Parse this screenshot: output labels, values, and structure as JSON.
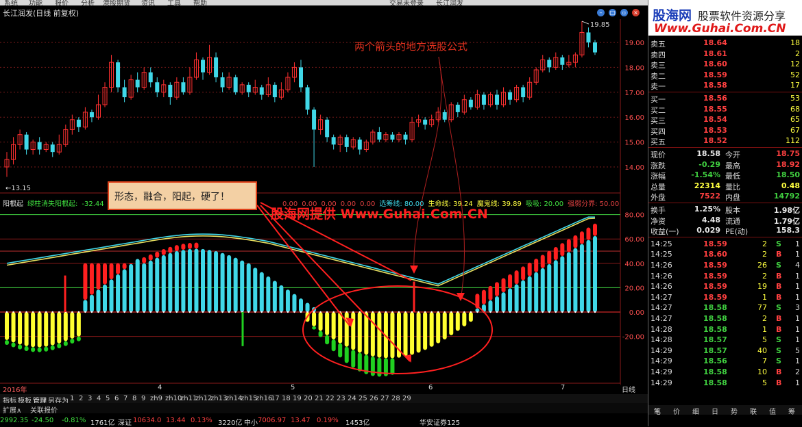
{
  "menubar": {
    "items": [
      "系统",
      "功能",
      "报价",
      "分析",
      "港股期货",
      "资讯",
      "工具",
      "帮助",
      "交易未登录",
      "长江润发"
    ]
  },
  "window": {
    "title": "长江润发(日线 前复权)"
  },
  "main_chart": {
    "price_axis": [
      "19.00",
      "18.00",
      "17.00",
      "16.00",
      "15.00",
      "14.00"
    ],
    "high_label": "19.85",
    "low_label": "13.15",
    "candles": [
      {
        "o": 14.0,
        "c": 14.3,
        "h": 14.6,
        "l": 13.6
      },
      {
        "o": 14.3,
        "c": 14.9,
        "h": 15.2,
        "l": 14.1
      },
      {
        "o": 14.9,
        "c": 15.3,
        "h": 15.5,
        "l": 14.7
      },
      {
        "o": 15.3,
        "c": 14.7,
        "h": 15.4,
        "l": 14.5
      },
      {
        "o": 14.7,
        "c": 15.0,
        "h": 15.1,
        "l": 14.5
      },
      {
        "o": 15.0,
        "c": 14.7,
        "h": 15.2,
        "l": 14.5
      },
      {
        "o": 14.7,
        "c": 14.9,
        "h": 15.0,
        "l": 14.6
      },
      {
        "o": 14.9,
        "c": 14.6,
        "h": 15.0,
        "l": 14.4
      },
      {
        "o": 14.6,
        "c": 14.9,
        "h": 15.3,
        "l": 14.5
      },
      {
        "o": 14.9,
        "c": 15.5,
        "h": 15.7,
        "l": 14.8
      },
      {
        "o": 15.5,
        "c": 15.9,
        "h": 16.1,
        "l": 15.3
      },
      {
        "o": 15.9,
        "c": 15.6,
        "h": 16.0,
        "l": 15.4
      },
      {
        "o": 15.6,
        "c": 16.2,
        "h": 16.4,
        "l": 15.5
      },
      {
        "o": 16.2,
        "c": 16.0,
        "h": 16.3,
        "l": 15.8
      },
      {
        "o": 16.0,
        "c": 16.5,
        "h": 16.9,
        "l": 15.9
      },
      {
        "o": 16.5,
        "c": 17.2,
        "h": 17.4,
        "l": 16.4
      },
      {
        "o": 17.2,
        "c": 18.2,
        "h": 18.5,
        "l": 17.0
      },
      {
        "o": 18.2,
        "c": 17.2,
        "h": 18.3,
        "l": 17.0
      },
      {
        "o": 17.2,
        "c": 16.8,
        "h": 17.5,
        "l": 16.6
      },
      {
        "o": 16.8,
        "c": 17.5,
        "h": 17.7,
        "l": 16.7
      },
      {
        "o": 17.5,
        "c": 17.2,
        "h": 17.8,
        "l": 17.0
      },
      {
        "o": 17.2,
        "c": 17.8,
        "h": 18.0,
        "l": 17.1
      },
      {
        "o": 17.8,
        "c": 17.4,
        "h": 18.0,
        "l": 17.2
      },
      {
        "o": 17.4,
        "c": 17.0,
        "h": 17.6,
        "l": 16.8
      },
      {
        "o": 17.0,
        "c": 17.3,
        "h": 17.5,
        "l": 16.8
      },
      {
        "o": 17.3,
        "c": 16.8,
        "h": 17.4,
        "l": 16.5
      },
      {
        "o": 16.8,
        "c": 17.4,
        "h": 17.6,
        "l": 16.7
      },
      {
        "o": 17.4,
        "c": 17.0,
        "h": 17.6,
        "l": 16.9
      },
      {
        "o": 17.0,
        "c": 17.6,
        "h": 18.0,
        "l": 16.9
      },
      {
        "o": 17.6,
        "c": 18.3,
        "h": 18.6,
        "l": 17.5
      },
      {
        "o": 18.3,
        "c": 17.8,
        "h": 18.4,
        "l": 17.5
      },
      {
        "o": 17.8,
        "c": 18.4,
        "h": 18.9,
        "l": 17.7
      },
      {
        "o": 18.4,
        "c": 17.6,
        "h": 18.6,
        "l": 17.4
      },
      {
        "o": 17.6,
        "c": 17.2,
        "h": 17.8,
        "l": 17.0
      },
      {
        "o": 17.2,
        "c": 17.6,
        "h": 17.8,
        "l": 17.1
      },
      {
        "o": 17.6,
        "c": 17.0,
        "h": 17.7,
        "l": 16.9
      },
      {
        "o": 17.0,
        "c": 17.3,
        "h": 17.4,
        "l": 16.9
      },
      {
        "o": 17.3,
        "c": 17.0,
        "h": 17.4,
        "l": 16.8
      },
      {
        "o": 17.0,
        "c": 17.2,
        "h": 17.5,
        "l": 16.9
      },
      {
        "o": 17.2,
        "c": 16.9,
        "h": 17.3,
        "l": 16.7
      },
      {
        "o": 16.9,
        "c": 17.3,
        "h": 17.6,
        "l": 16.8
      },
      {
        "o": 17.3,
        "c": 16.8,
        "h": 17.4,
        "l": 16.6
      },
      {
        "o": 16.8,
        "c": 17.1,
        "h": 17.4,
        "l": 16.7
      },
      {
        "o": 17.1,
        "c": 17.6,
        "h": 17.8,
        "l": 17.0
      },
      {
        "o": 17.6,
        "c": 18.0,
        "h": 18.2,
        "l": 17.4
      },
      {
        "o": 18.0,
        "c": 17.2,
        "h": 18.3,
        "l": 17.0
      },
      {
        "o": 17.2,
        "c": 16.3,
        "h": 17.3,
        "l": 16.1
      },
      {
        "o": 16.3,
        "c": 15.5,
        "h": 16.4,
        "l": 14.0
      },
      {
        "o": 15.5,
        "c": 15.9,
        "h": 16.1,
        "l": 15.3
      },
      {
        "o": 15.9,
        "c": 15.2,
        "h": 16.0,
        "l": 15.0
      },
      {
        "o": 15.2,
        "c": 14.9,
        "h": 15.3,
        "l": 14.7
      },
      {
        "o": 14.9,
        "c": 15.2,
        "h": 15.3,
        "l": 14.6
      },
      {
        "o": 15.2,
        "c": 14.8,
        "h": 15.3,
        "l": 14.6
      },
      {
        "o": 14.8,
        "c": 15.1,
        "h": 15.2,
        "l": 14.7
      },
      {
        "o": 15.1,
        "c": 14.7,
        "h": 15.2,
        "l": 14.5
      },
      {
        "o": 14.7,
        "c": 15.0,
        "h": 15.1,
        "l": 14.6
      },
      {
        "o": 15.0,
        "c": 15.4,
        "h": 15.5,
        "l": 14.9
      },
      {
        "o": 15.4,
        "c": 15.1,
        "h": 15.6,
        "l": 15.0
      },
      {
        "o": 15.1,
        "c": 15.3,
        "h": 15.4,
        "l": 15.0
      },
      {
        "o": 15.3,
        "c": 15.1,
        "h": 15.4,
        "l": 15.0
      },
      {
        "o": 15.1,
        "c": 15.3,
        "h": 15.4,
        "l": 15.0
      },
      {
        "o": 15.3,
        "c": 15.1,
        "h": 15.4,
        "l": 14.9
      },
      {
        "o": 15.1,
        "c": 15.8,
        "h": 16.0,
        "l": 15.0
      },
      {
        "o": 15.8,
        "c": 15.9,
        "h": 16.1,
        "l": 15.6
      },
      {
        "o": 15.9,
        "c": 15.7,
        "h": 16.0,
        "l": 15.5
      },
      {
        "o": 15.7,
        "c": 15.9,
        "h": 16.1,
        "l": 15.6
      },
      {
        "o": 15.9,
        "c": 16.2,
        "h": 16.4,
        "l": 15.8
      },
      {
        "o": 16.2,
        "c": 15.9,
        "h": 16.3,
        "l": 15.8
      },
      {
        "o": 15.9,
        "c": 16.5,
        "h": 16.6,
        "l": 15.8
      },
      {
        "o": 16.5,
        "c": 16.2,
        "h": 16.6,
        "l": 16.0
      },
      {
        "o": 16.2,
        "c": 16.7,
        "h": 16.9,
        "l": 16.1
      },
      {
        "o": 16.7,
        "c": 16.4,
        "h": 16.8,
        "l": 16.3
      },
      {
        "o": 16.4,
        "c": 16.9,
        "h": 17.1,
        "l": 16.3
      },
      {
        "o": 16.9,
        "c": 16.5,
        "h": 17.0,
        "l": 16.3
      },
      {
        "o": 16.5,
        "c": 16.9,
        "h": 17.0,
        "l": 16.4
      },
      {
        "o": 16.9,
        "c": 16.5,
        "h": 17.1,
        "l": 16.3
      },
      {
        "o": 16.5,
        "c": 17.0,
        "h": 17.2,
        "l": 16.4
      },
      {
        "o": 17.0,
        "c": 16.7,
        "h": 17.1,
        "l": 16.5
      },
      {
        "o": 16.7,
        "c": 17.2,
        "h": 17.3,
        "l": 16.6
      },
      {
        "o": 17.2,
        "c": 16.8,
        "h": 17.3,
        "l": 16.6
      },
      {
        "o": 16.8,
        "c": 17.4,
        "h": 17.6,
        "l": 16.7
      },
      {
        "o": 17.4,
        "c": 17.9,
        "h": 18.0,
        "l": 17.3
      },
      {
        "o": 17.9,
        "c": 18.3,
        "h": 18.5,
        "l": 17.8
      },
      {
        "o": 18.3,
        "c": 18.0,
        "h": 18.4,
        "l": 17.8
      },
      {
        "o": 18.0,
        "c": 18.4,
        "h": 18.6,
        "l": 17.9
      },
      {
        "o": 18.4,
        "c": 18.1,
        "h": 18.5,
        "l": 17.9
      },
      {
        "o": 18.1,
        "c": 18.2,
        "h": 18.5,
        "l": 18.0
      },
      {
        "o": 18.2,
        "c": 18.5,
        "h": 18.6,
        "l": 18.0
      },
      {
        "o": 18.5,
        "c": 19.4,
        "h": 19.85,
        "l": 18.4
      },
      {
        "o": 19.4,
        "c": 19.0,
        "h": 19.6,
        "l": 18.8
      },
      {
        "o": 19.0,
        "c": 18.6,
        "h": 19.1,
        "l": 18.5
      }
    ]
  },
  "indicator": {
    "name": "阳根起",
    "line1_label": "绿柱消失阳根起:",
    "line1_value": "-32.44",
    "v1": "0.00",
    "v2": "0.00",
    "v3": "0.00",
    "v4": "0.00",
    "v5": "0.00",
    "xuanchou": "选筹线: 80.00",
    "shengming": "生命线: 39.24",
    "mogui": "魔鬼线: 39.89",
    "xixi": "吸吸: 20.00",
    "qiangruo": "强弱分界: 50.00",
    "axis": [
      "80.00",
      "60.00",
      "40.00",
      "20.00",
      "0.00",
      "-20.00"
    ]
  },
  "annotation": {
    "box_text": "形态，融合，阳起，硬了！",
    "arrow_note": "两个箭头的地方选股公式",
    "watermark": "股海网提供 Www.Guhai.Com.CN"
  },
  "xaxis": {
    "year": "2016年",
    "months": [
      "4",
      "5",
      "6",
      "7"
    ],
    "right_label": "日线"
  },
  "tabs": {
    "items": [
      "指标",
      "模板",
      "管理",
      "另存为",
      "1",
      "2",
      "3",
      "4",
      "5",
      "6",
      "7",
      "8",
      "9",
      "zh9",
      "zh10",
      "zh11",
      "zh12",
      "zh13",
      "zh14",
      "zh15",
      "zh16",
      "17",
      "18",
      "19",
      "20",
      "21",
      "22",
      "23",
      "24",
      "25",
      "26",
      "27",
      "28",
      "29"
    ]
  },
  "bottom_bar": {
    "items": [
      "扩展∧",
      "关联报价"
    ]
  },
  "status": {
    "sh_value": "2992.35",
    "sh_change": "-24.50",
    "sh_pct": "-0.81%",
    "sh_vol": "1761亿",
    "sz_label": "深证",
    "sz_value": "10634.0",
    "sz_change": "13.44",
    "sz_pct": "0.13%",
    "sz_vol": "3220亿",
    "zx_label": "中小",
    "zx_value": "7006.97",
    "zx_change": "13.47",
    "zx_pct": "0.19%",
    "zx_vol": "1453亿",
    "broker": "华安证券125"
  },
  "logo": {
    "main": "股海网",
    "sub": "股票软件资源分享",
    "url": "Www.Guhai.Com.CN"
  },
  "orderbook": {
    "asks": [
      {
        "label": "卖五",
        "price": "18.64",
        "vol": "18"
      },
      {
        "label": "卖四",
        "price": "18.61",
        "vol": "2"
      },
      {
        "label": "卖三",
        "price": "18.60",
        "vol": "12"
      },
      {
        "label": "卖二",
        "price": "18.59",
        "vol": "52"
      },
      {
        "label": "卖一",
        "price": "18.58",
        "vol": "17"
      }
    ],
    "bids": [
      {
        "label": "买一",
        "price": "18.56",
        "vol": "53"
      },
      {
        "label": "买二",
        "price": "18.55",
        "vol": "68"
      },
      {
        "label": "买三",
        "price": "18.54",
        "vol": "65"
      },
      {
        "label": "买四",
        "price": "18.53",
        "vol": "67"
      },
      {
        "label": "买五",
        "price": "18.52",
        "vol": "112"
      }
    ]
  },
  "quote": [
    {
      "l1": "现价",
      "v1": "18.58",
      "l2": "今开",
      "v2": "18.75",
      "c1": "#e8e8e8",
      "c2": "#ff4040"
    },
    {
      "l1": "涨跌",
      "v1": "-0.29",
      "l2": "最高",
      "v2": "18.92",
      "c1": "#40d040",
      "c2": "#ff4040"
    },
    {
      "l1": "涨幅",
      "v1": "-1.54%",
      "l2": "最低",
      "v2": "18.50",
      "c1": "#40d040",
      "c2": "#40d040"
    },
    {
      "l1": "总量",
      "v1": "22314",
      "l2": "量比",
      "v2": "0.48",
      "c1": "#ffff40",
      "c2": "#ffff40"
    },
    {
      "l1": "外盘",
      "v1": "7522",
      "l2": "内盘",
      "v2": "14792",
      "c1": "#ff4040",
      "c2": "#40d040"
    },
    {
      "l1": "换手",
      "v1": "1.25%",
      "l2": "股本",
      "v2": "1.98亿",
      "c1": "#e8e8e8",
      "c2": "#e8e8e8"
    },
    {
      "l1": "净资",
      "v1": "4.48",
      "l2": "流通",
      "v2": "1.79亿",
      "c1": "#e8e8e8",
      "c2": "#e8e8e8"
    },
    {
      "l1": "收益(一)",
      "v1": "0.029",
      "l2": "PE(动)",
      "v2": "158.3",
      "c1": "#e8e8e8",
      "c2": "#e8e8e8"
    }
  ],
  "ticks": [
    {
      "t": "14:25",
      "p": "18.59",
      "v": "2",
      "s": "S",
      "n": "1",
      "pc": "#ff4040",
      "sc": "#40d040"
    },
    {
      "t": "14:25",
      "p": "18.60",
      "v": "2",
      "s": "B",
      "n": "1",
      "pc": "#ff4040",
      "sc": "#ff4040"
    },
    {
      "t": "14:26",
      "p": "18.59",
      "v": "26",
      "s": "S",
      "n": "4",
      "pc": "#ff4040",
      "sc": "#40d040"
    },
    {
      "t": "14:26",
      "p": "18.59",
      "v": "2",
      "s": "B",
      "n": "1",
      "pc": "#ff4040",
      "sc": "#ff4040"
    },
    {
      "t": "14:26",
      "p": "18.59",
      "v": "19",
      "s": "B",
      "n": "1",
      "pc": "#ff4040",
      "sc": "#ff4040"
    },
    {
      "t": "14:27",
      "p": "18.59",
      "v": "1",
      "s": "B",
      "n": "1",
      "pc": "#ff4040",
      "sc": "#ff4040"
    },
    {
      "t": "14:27",
      "p": "18.58",
      "v": "77",
      "s": "S",
      "n": "3",
      "pc": "#40d040",
      "sc": "#40d040"
    },
    {
      "t": "14:27",
      "p": "18.58",
      "v": "2",
      "s": "B",
      "n": "1",
      "pc": "#40d040",
      "sc": "#ff4040"
    },
    {
      "t": "14:28",
      "p": "18.58",
      "v": "1",
      "s": "B",
      "n": "1",
      "pc": "#40d040",
      "sc": "#ff4040"
    },
    {
      "t": "14:28",
      "p": "18.57",
      "v": "5",
      "s": "S",
      "n": "1",
      "pc": "#40d040",
      "sc": "#40d040"
    },
    {
      "t": "14:29",
      "p": "18.57",
      "v": "40",
      "s": "S",
      "n": "5",
      "pc": "#40d040",
      "sc": "#40d040"
    },
    {
      "t": "14:29",
      "p": "18.56",
      "v": "7",
      "s": "S",
      "n": "1",
      "pc": "#40d040",
      "sc": "#40d040"
    },
    {
      "t": "14:29",
      "p": "18.58",
      "v": "10",
      "s": "B",
      "n": "2",
      "pc": "#40d040",
      "sc": "#ff4040"
    },
    {
      "t": "14:29",
      "p": "18.58",
      "v": "5",
      "s": "B",
      "n": "1",
      "pc": "#40d040",
      "sc": "#ff4040"
    }
  ],
  "panel_tabs": [
    "笔",
    "价",
    "细",
    "日",
    "势",
    "联",
    "值",
    "筹"
  ]
}
